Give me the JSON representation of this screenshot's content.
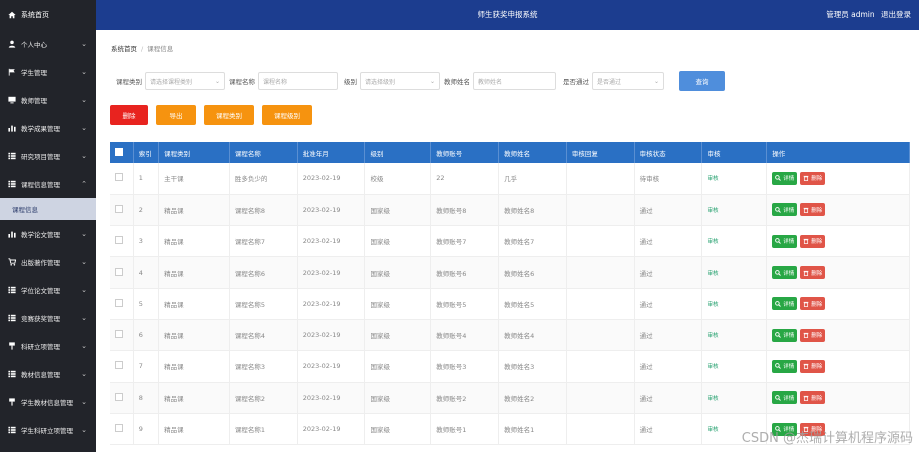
{
  "sidebar": {
    "home": "系统首页",
    "items": [
      {
        "label": "个人中心",
        "icon": "user-icon"
      },
      {
        "label": "学生管理",
        "icon": "flag-icon"
      },
      {
        "label": "教师管理",
        "icon": "monitor-icon"
      },
      {
        "label": "教学成果管理",
        "icon": "chart-icon"
      },
      {
        "label": "研究项目管理",
        "icon": "list-icon"
      },
      {
        "label": "课程信息管理",
        "icon": "list-icon",
        "expanded": true
      }
    ],
    "active_sub": "课程信息",
    "items2": [
      {
        "label": "教学论文管理",
        "icon": "chart-icon"
      },
      {
        "label": "出版著作管理",
        "icon": "cart-icon"
      },
      {
        "label": "学位论文管理",
        "icon": "list-icon"
      },
      {
        "label": "竞赛获奖管理",
        "icon": "list-icon"
      },
      {
        "label": "科研立项管理",
        "icon": "paint-icon"
      },
      {
        "label": "教材信息管理",
        "icon": "list-icon"
      },
      {
        "label": "学生教材信息管理",
        "icon": "paint-icon"
      },
      {
        "label": "学生科研立项管理",
        "icon": "list-icon"
      }
    ]
  },
  "header": {
    "title": "师生获奖申报系统",
    "admin": "管理员 admin",
    "logout": "退出登录"
  },
  "breadcrumb": {
    "home": "系统首页",
    "current": "课程信息"
  },
  "filters": {
    "course_type_label": "课程类别",
    "course_type_placeholder": "请选择课程类别",
    "course_name_label": "课程名称",
    "course_name_placeholder": "课程名称",
    "level_label": "级别",
    "level_placeholder": "请选择级别",
    "teacher_name_label": "教师姓名",
    "teacher_name_placeholder": "教师姓名",
    "passed_label": "是否通过",
    "passed_placeholder": "是否通过",
    "query": "查询"
  },
  "actions": {
    "delete": "删除",
    "export": "导出",
    "course_type": "课程类别",
    "course_level": "课程级别"
  },
  "table": {
    "headers": [
      "索引",
      "课程类别",
      "课程名称",
      "批准年月",
      "级别",
      "教师账号",
      "教师姓名",
      "审核回复",
      "审核状态",
      "审核",
      "操作"
    ],
    "audit_label": "审核",
    "detail_label": "详情",
    "delete_label": "删除",
    "rows": [
      [
        "1",
        "主干课",
        "胜多负少的",
        "2023-02-19",
        "校级",
        "22",
        "几乎",
        "",
        "待审核"
      ],
      [
        "2",
        "精品课",
        "课程名称8",
        "2023-02-19",
        "国家级",
        "教师账号8",
        "教师姓名8",
        "",
        "通过"
      ],
      [
        "3",
        "精品课",
        "课程名称7",
        "2023-02-19",
        "国家级",
        "教师账号7",
        "教师姓名7",
        "",
        "通过"
      ],
      [
        "4",
        "精品课",
        "课程名称6",
        "2023-02-19",
        "国家级",
        "教师账号6",
        "教师姓名6",
        "",
        "通过"
      ],
      [
        "5",
        "精品课",
        "课程名称5",
        "2023-02-19",
        "国家级",
        "教师账号5",
        "教师姓名5",
        "",
        "通过"
      ],
      [
        "6",
        "精品课",
        "课程名称4",
        "2023-02-19",
        "国家级",
        "教师账号4",
        "教师姓名4",
        "",
        "通过"
      ],
      [
        "7",
        "精品课",
        "课程名称3",
        "2023-02-19",
        "国家级",
        "教师账号3",
        "教师姓名3",
        "",
        "通过"
      ],
      [
        "8",
        "精品课",
        "课程名称2",
        "2023-02-19",
        "国家级",
        "教师账号2",
        "教师姓名2",
        "",
        "通过"
      ],
      [
        "9",
        "精品课",
        "课程名称1",
        "2023-02-19",
        "国家级",
        "教师账号1",
        "教师姓名1",
        "",
        "通过"
      ]
    ]
  },
  "watermark": "CSDN @杰瑞计算机程序源码"
}
